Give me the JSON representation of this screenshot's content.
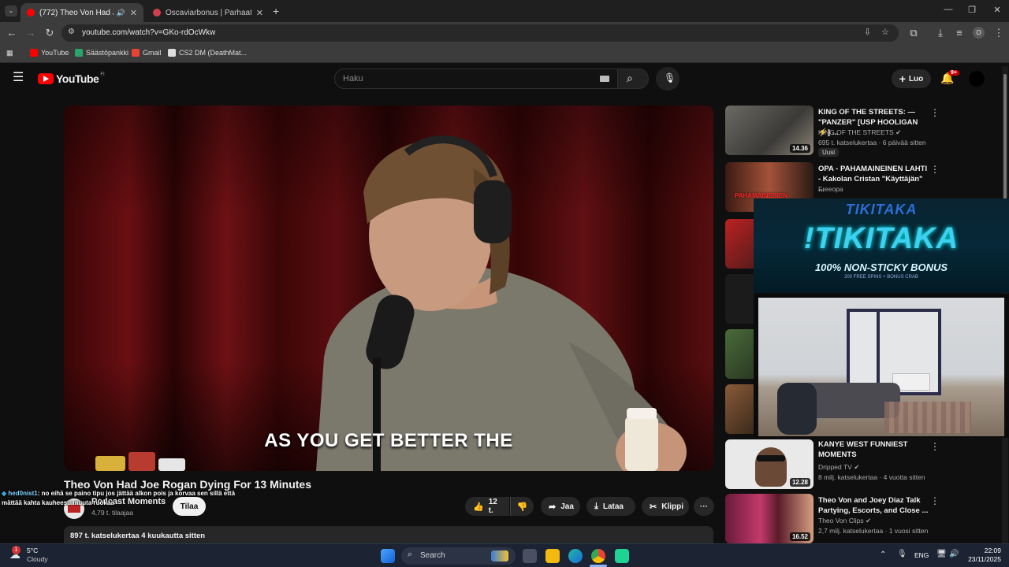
{
  "browser": {
    "tabs": [
      {
        "title": "(772) Theo Von Had Joe Ro",
        "active": true
      },
      {
        "title": "Oscaviarbonus | Parhaat talletu",
        "active": false
      }
    ],
    "url": "youtube.com/watch?v=GKo-rdOcWkw",
    "bookmarks": [
      "YouTube",
      "Säästöpankki",
      "Gmail",
      "CS2 DM (DeathMat..."
    ],
    "new_tab": "+",
    "profile_initial": "O"
  },
  "youtube": {
    "logo_text": "YouTube",
    "region": "FI",
    "search_placeholder": "Haku",
    "create_label": "Luo",
    "notif_count": "9+"
  },
  "video": {
    "caption": "AS YOU GET BETTER THE",
    "title": "Theo Von Had Joe Rogan Dying For 13 Minutes",
    "channel": "Podcast Moments",
    "subscribers": "4,79 t. tilaajaa",
    "subscribe_label": "Tilaa",
    "likes": "12 t.",
    "share_label": "Jaa",
    "download_label": "Lataa",
    "clip_label": "Klippi",
    "more_label": "···",
    "views_date": "897 t. katselukertaa  4 kuukautta sitten"
  },
  "chat_overlay": {
    "user": "hed0nist1",
    "text": ": no eihä se paino tipu jos jättää alkon pois ja korvaa sen sillä että mättää kahta kauheesti muuta ruokaa"
  },
  "recommendations": [
    {
      "title": "KING OF THE STREETS: — \"PANZER\" [USP HOOLIGAN ⚡] ...",
      "channel": "KING OF THE STREETS",
      "verified": true,
      "meta": "695 t. katselukertaa · 6 päivää sitten",
      "badge": "Uusi",
      "duration": "14.36"
    },
    {
      "title": "OPA - PAHAMAINEINEN LAHTI - Kakolan Cristan \"Käyttäjän\" ...",
      "channel": "Freeopa",
      "verified": false,
      "meta": "",
      "badge": "",
      "duration": "",
      "thumb_text": "PAHAMAINEINEN"
    },
    {
      "title": "KANYE WEST FUNNIEST MOMENTS",
      "channel": "Dripped TV",
      "verified": true,
      "meta": "8 milj. katselukertaa · 4 vuotta sitten",
      "badge": "",
      "duration": "12.28"
    },
    {
      "title": "Theo Von and Joey Diaz Talk Partying, Escorts, and Close ...",
      "channel": "Theo Von Clips",
      "verified": true,
      "meta": "2,7 milj. katselukertaa · 1 vuosi sitten",
      "badge": "",
      "duration": "16.52"
    }
  ],
  "ad_overlay": {
    "logo": "TIKITAKA",
    "headline": "!TIKITAKA",
    "subline": "100% NON-STICKY BONUS",
    "small": "200 FREE SPINS + BONUS CRAB"
  },
  "taskbar": {
    "temp": "5°C",
    "weather": "Cloudy",
    "weather_badge": "1",
    "search_label": "Search",
    "lang": "ENG",
    "time": "22:09",
    "date": "23/11/2025"
  },
  "colors": {
    "yt_red": "#ff0000",
    "bg": "#0f0f0f",
    "chip": "#272727",
    "ad_cyan": "#3fd0f0"
  }
}
